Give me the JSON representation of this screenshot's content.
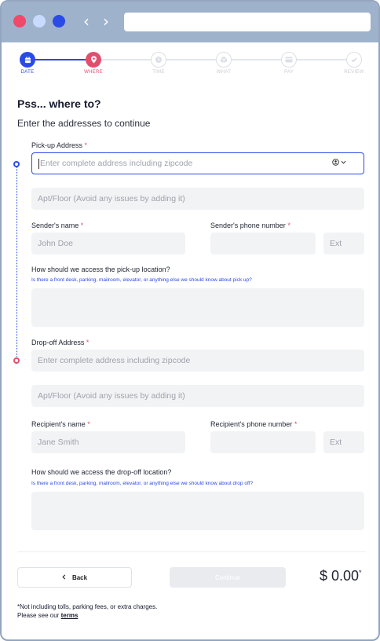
{
  "stepper": [
    {
      "label": "DATE",
      "state": "done",
      "icon": "calendar-icon"
    },
    {
      "label": "WHERE",
      "state": "current",
      "icon": "location-pin-icon"
    },
    {
      "label": "TIME",
      "state": "todo",
      "icon": "clock-icon"
    },
    {
      "label": "WHAT",
      "state": "todo",
      "icon": "package-icon"
    },
    {
      "label": "PAY",
      "state": "todo",
      "icon": "credit-card-icon"
    },
    {
      "label": "REVIEW",
      "state": "todo",
      "icon": "check-icon"
    }
  ],
  "heading": "Pss... where to?",
  "subheading": "Enter the addresses to continue",
  "pickup": {
    "address_label": "Pick-up Address",
    "address_placeholder": "Enter complete address including zipcode",
    "apt_placeholder": "Apt/Floor (Avoid any issues by adding it)",
    "name_label": "Sender's name",
    "name_placeholder": "John Doe",
    "phone_label": "Sender's phone number",
    "ext_placeholder": "Ext",
    "access_label": "How should we access the pick-up location?",
    "access_hint": "Is there a front desk, parking, mailroom, elevator, or anything else we should know about pick up?"
  },
  "dropoff": {
    "address_label": "Drop-off Address",
    "address_placeholder": "Enter complete address including zipcode",
    "apt_placeholder": "Apt/Floor (Avoid any issues by adding it)",
    "name_label": "Recipient's name",
    "name_placeholder": "Jane Smith",
    "phone_label": "Recipient's phone number",
    "ext_placeholder": "Ext",
    "access_label": "How should we access the drop-off location?",
    "access_hint": "Is there a front desk, parking, mailroom, elevator, or anything else we should know about drop off?"
  },
  "required_mark": "*",
  "footer": {
    "back_label": "Back",
    "continue_label": "Continue",
    "price": "$ 0.00",
    "price_mark": "*",
    "note_line1": "*Not including tolls, parking fees, or extra charges.",
    "note_line2": "Please see our",
    "terms_link": "terms"
  },
  "colors": {
    "accent_blue": "#2a4be8",
    "accent_red": "#e0506e",
    "window_chrome": "#9fb2cc"
  }
}
